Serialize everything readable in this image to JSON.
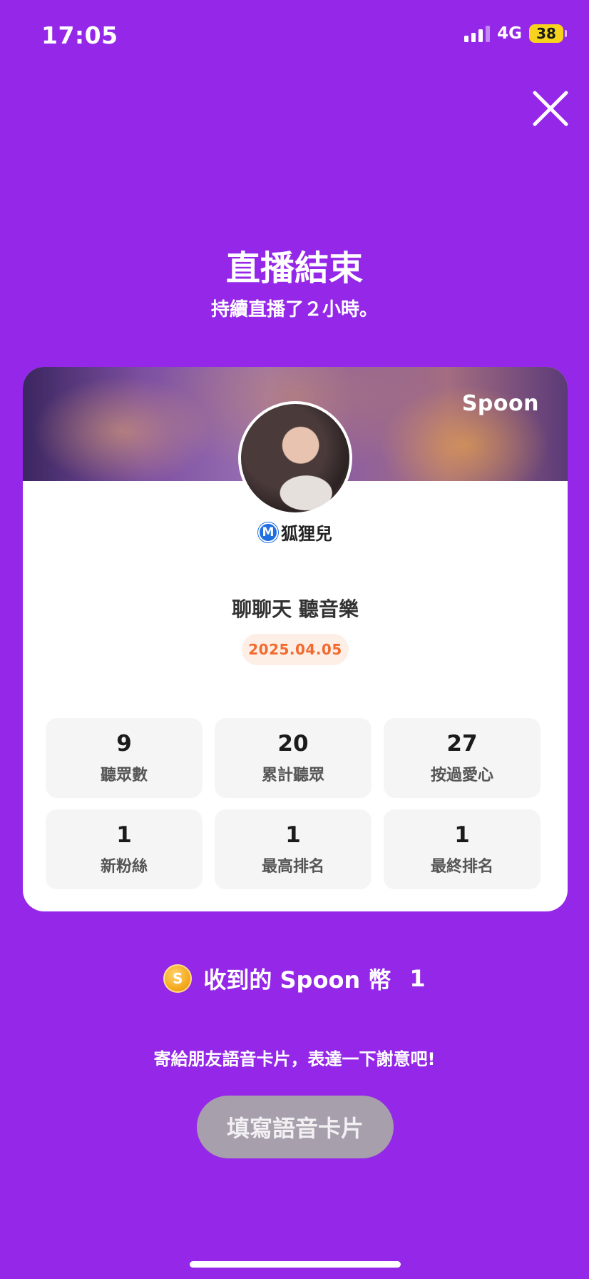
{
  "status_bar": {
    "time": "17:05",
    "network": "4G",
    "battery": "38"
  },
  "header": {
    "title": "直播結束",
    "subtitle": "持續直播了２小時。"
  },
  "card": {
    "brand": "Spoon",
    "badge_letter": "M",
    "username": "狐狸兒",
    "stream_title": "聊聊天 聽音樂",
    "date": "2025.04.05",
    "stats": [
      {
        "value": "9",
        "label": "聽眾數"
      },
      {
        "value": "20",
        "label": "累計聽眾"
      },
      {
        "value": "27",
        "label": "按過愛心"
      },
      {
        "value": "1",
        "label": "新粉絲"
      },
      {
        "value": "1",
        "label": "最高排名"
      },
      {
        "value": "1",
        "label": "最終排名"
      }
    ]
  },
  "coins": {
    "icon_letter": "S",
    "label": "收到的 Spoon 幣",
    "value": "1"
  },
  "footer": {
    "thanks_text": "寄給朋友語音卡片，表達一下謝意吧!",
    "button_label": "填寫語音卡片"
  },
  "colors": {
    "background": "#9427e8",
    "date_text": "#f26a2e",
    "button_bg": "#a79fac"
  },
  "icons": {
    "close": "close-icon",
    "coin": "coin-icon",
    "signal": "signal-icon",
    "battery": "battery-icon"
  }
}
